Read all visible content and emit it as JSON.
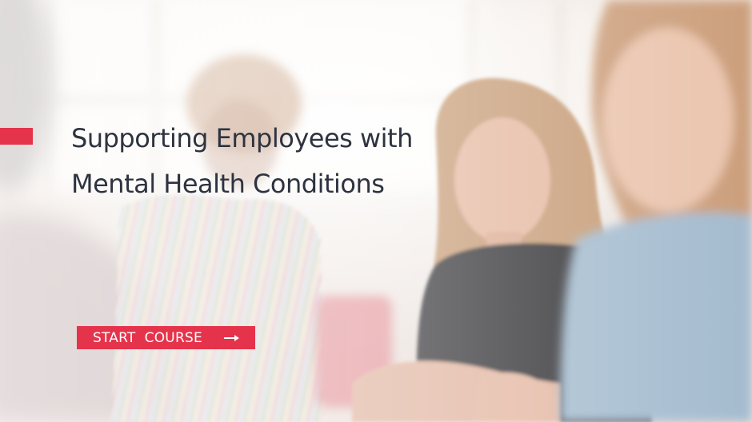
{
  "slide": {
    "title_lines": [
      "Supporting Employees with",
      "Mental Health Conditions"
    ],
    "start_button": {
      "label": "START  COURSE",
      "icon": "arrow-right-icon"
    }
  },
  "colors": {
    "accent": "#e5334b",
    "title_text": "#2d3340",
    "button_text": "#ffffff",
    "background": "#efe7e2"
  }
}
